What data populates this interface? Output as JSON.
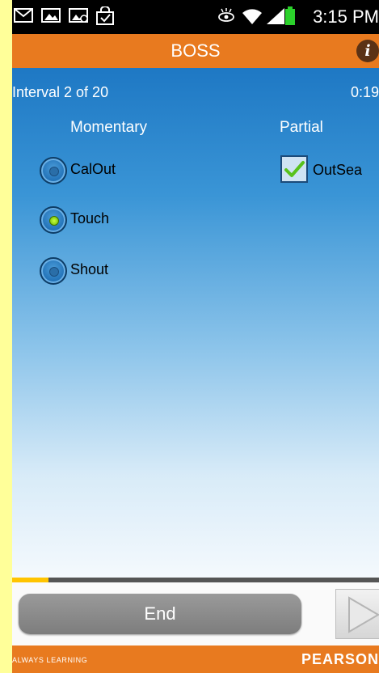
{
  "status_bar": {
    "time": "3:15 PM",
    "left_icons": [
      "mail-icon",
      "gallery-icon",
      "mms-icon",
      "shopping-bag-icon"
    ],
    "right_icons": [
      "eye-icon",
      "wifi-icon",
      "signal-icon",
      "battery-icon"
    ]
  },
  "app": {
    "title": "BOSS",
    "info_label": "i"
  },
  "session": {
    "interval": "Interval 2 of 20",
    "timer": "0:19"
  },
  "columns": {
    "momentary": "Momentary",
    "partial": "Partial"
  },
  "momentary_options": [
    {
      "label": "CalOut",
      "selected": false
    },
    {
      "label": "Touch",
      "selected": true
    },
    {
      "label": "Shout",
      "selected": false
    }
  ],
  "partial_options": [
    {
      "label": "OutSea",
      "checked": true
    }
  ],
  "progress": {
    "value_fraction": 0.1
  },
  "controls": {
    "end_label": "End",
    "play_icon": "play-icon"
  },
  "footer": {
    "left": "ALWAYS LEARNING",
    "right": "PEARSON"
  },
  "colors": {
    "orange": "#e87a1f",
    "blue": "#1e78c4",
    "highlight": "#ffff99"
  }
}
